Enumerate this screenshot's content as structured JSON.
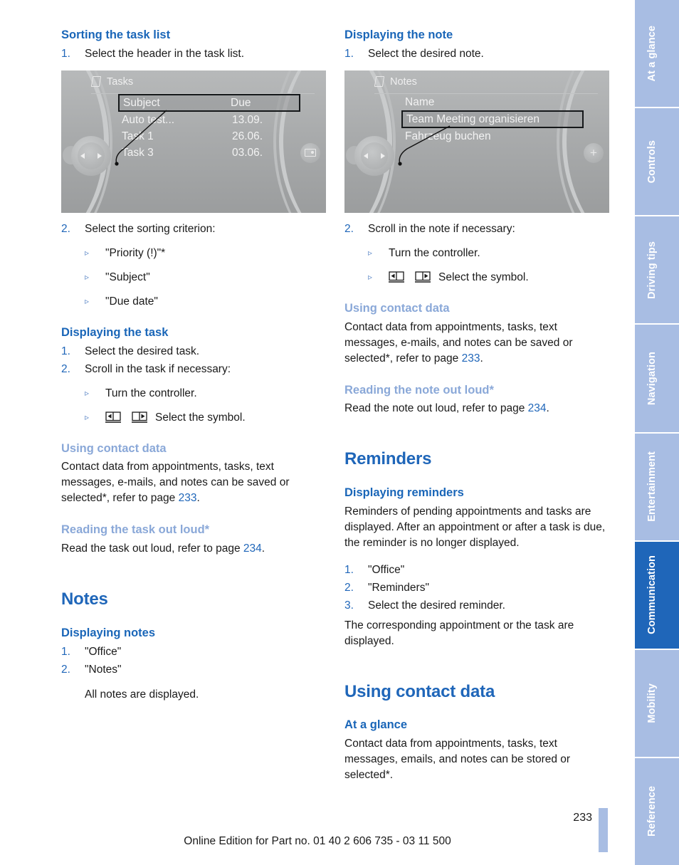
{
  "rail": {
    "tabs": [
      {
        "label": "At a glance",
        "active": false
      },
      {
        "label": "Controls",
        "active": false
      },
      {
        "label": "Driving tips",
        "active": false
      },
      {
        "label": "Navigation",
        "active": false
      },
      {
        "label": "Entertainment",
        "active": false
      },
      {
        "label": "Communication",
        "active": true
      },
      {
        "label": "Mobility",
        "active": false
      },
      {
        "label": "Reference",
        "active": false
      }
    ],
    "active_color": "#1f66b9",
    "inactive_color": "#a8bde3"
  },
  "left": {
    "h_sorting": "Sorting the task list",
    "step_select_header": "Select the header in the task list.",
    "screen_tasks": {
      "title": "Tasks",
      "header_row": {
        "subject": "Subject",
        "due": "Due"
      },
      "rows": [
        {
          "subject": "Auto test...",
          "due": "13.09."
        },
        {
          "subject": "Task 1",
          "due": "26.06."
        },
        {
          "subject": "Task 3",
          "due": "03.06."
        }
      ]
    },
    "step_sorting_criterion": "Select the sorting criterion:",
    "criteria": [
      "\"Priority (!)\"*",
      "\"Subject\"",
      "\"Due date\""
    ],
    "h_displaying_task": "Displaying the task",
    "step_select_task": "Select the desired task.",
    "step_scroll_task": "Scroll in the task if necessary:",
    "scroll_turn": "Turn the controller.",
    "scroll_symbol": "Select the symbol.",
    "h_using_contact_data": "Using contact data",
    "contact_text_1": "Contact data from appointments, tasks, text messages, e-mails, and notes can be saved or selected*, refer to page ",
    "contact_page": "233",
    "contact_text_2": ".",
    "h_reading_task": "Reading the task out loud*",
    "reading_text_1": "Read the task out loud, refer to page ",
    "reading_page": "234",
    "reading_text_2": ".",
    "h_notes": "Notes",
    "h_displaying_notes": "Displaying notes",
    "notes_steps": [
      "\"Office\"",
      "\"Notes\""
    ],
    "notes_result": "All notes are displayed."
  },
  "right": {
    "h_displaying_note": "Displaying the note",
    "step_select_note": "Select the desired note.",
    "screen_notes": {
      "title": "Notes",
      "header_label": "Name",
      "rows": [
        {
          "name": "Team Meeting organisieren",
          "selected": true
        },
        {
          "name": "Fahrzeug buchen",
          "selected": false
        }
      ]
    },
    "step_scroll_note": "Scroll in the note if necessary:",
    "scroll_turn": "Turn the controller.",
    "scroll_symbol": "Select the symbol.",
    "h_using_contact_data": "Using contact data",
    "contact_text_1": "Contact data from appointments, tasks, text messages, e-mails, and notes can be saved or selected*, refer to page ",
    "contact_page": "233",
    "contact_text_2": ".",
    "h_reading_note": "Reading the note out loud*",
    "reading_text_1": "Read the note out loud, refer to page ",
    "reading_page": "234",
    "reading_text_2": ".",
    "h_reminders": "Reminders",
    "h_displaying_reminders": "Displaying reminders",
    "reminders_text": "Reminders of pending appointments and tasks are displayed. After an appointment or after a task is due, the reminder is no longer displayed.",
    "reminders_steps": [
      "\"Office\"",
      "\"Reminders\"",
      "Select the desired reminder."
    ],
    "reminders_result": "The corresponding appointment or the task are displayed.",
    "h_using_contact_data_2": "Using contact data",
    "h_at_a_glance": "At a glance",
    "at_a_glance_text": "Contact data from appointments, tasks, text messages, emails, and notes can be stored or selected*."
  },
  "numbers": {
    "n1": "1.",
    "n2": "2.",
    "n3": "3."
  },
  "icons": {
    "bullet_triangle": "▹",
    "book_prev": "book-page-back-icon",
    "book_next": "book-page-forward-icon",
    "doc": "document-icon",
    "plus": "+",
    "card": "card-icon"
  },
  "footer": {
    "page_number": "233",
    "edition": "Online Edition for Part no. 01 40 2 606 735 - 03 11 500"
  }
}
